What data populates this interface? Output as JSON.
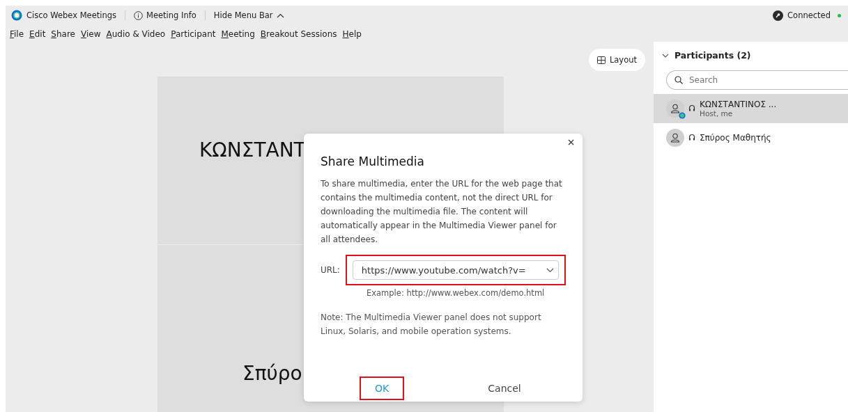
{
  "title_bar": {
    "app_name": "Cisco Webex Meetings",
    "meeting_info": "Meeting Info",
    "hide_menu": "Hide Menu Bar",
    "status": "Connected"
  },
  "menu": [
    "File",
    "Edit",
    "Share",
    "View",
    "Audio & Video",
    "Participant",
    "Meeting",
    "Breakout Sessions",
    "Help"
  ],
  "layout_button": "Layout",
  "tiles": [
    {
      "name": "ΚΩΝΣΤΑΝΤ"
    },
    {
      "name": "Σπύρο"
    }
  ],
  "dialog": {
    "title": "Share Multimedia",
    "description": "To share multimedia, enter the URL for the web page that contains the multimedia content, not the direct URL for downloading the multimedia file. The content will automatically appear in the Multimedia Viewer panel for all attendees.",
    "url_label": "URL:",
    "url_value": "https://www.youtube.com/watch?v=",
    "example": "Example: http://www.webex.com/demo.html",
    "note": "Note: The Multimedia Viewer panel does not support Linux, Solaris, and mobile operation systems.",
    "buttons": [
      {
        "label": "OK",
        "kind": "primary",
        "highlighted": true
      },
      {
        "label": "Cancel",
        "kind": "secondary",
        "highlighted": false
      }
    ],
    "url_highlighted": true
  },
  "participants": {
    "title": "Participants (2)",
    "expanded": true,
    "search_placeholder": "Search",
    "items": [
      {
        "name": "ΚΩΝΣΤΑΝΤΙΝΟΣ ...",
        "role": "Host, me",
        "selected": true,
        "host": true
      },
      {
        "name": "Σπύρος Μαθητής",
        "selected": false,
        "host": false
      }
    ]
  }
}
